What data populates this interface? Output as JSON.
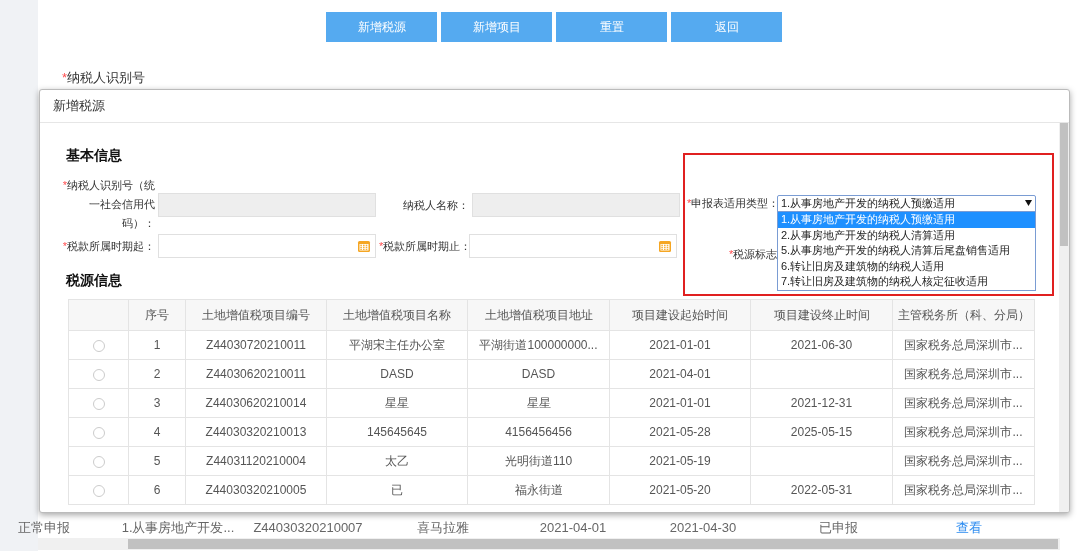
{
  "toolbar": {
    "buttons": [
      "新增税源",
      "新增项目",
      "重置",
      "返回"
    ]
  },
  "background_form": {
    "required_mark": "*",
    "label": "纳税人识别号"
  },
  "background_table_row": [
    "正常申报",
    "1.从事房地产开发...",
    "Z44030320210007",
    "喜马拉雅",
    "2021-04-01",
    "2021-04-30",
    "已申报"
  ],
  "background_table_link": "查看",
  "dialog": {
    "title": "新增税源",
    "basic_info": {
      "heading": "基本信息",
      "fields": [
        {
          "required_mark": "*",
          "label": "纳税人识别号（统一社会信用代码）：",
          "readonly": true,
          "kind": "text"
        },
        {
          "label": "纳税人名称：",
          "readonly": true,
          "kind": "text"
        },
        {
          "required_mark": "*",
          "label": "税款所属时期起：",
          "readonly": false,
          "kind": "date"
        },
        {
          "required_mark": "*",
          "label": "税款所属时期止：",
          "readonly": false,
          "kind": "date"
        }
      ],
      "declaration_type": {
        "required_mark": "*",
        "label": "申报表适用类型：",
        "value": "1.从事房地产开发的纳税人预缴适用",
        "expanded": true,
        "options": [
          {
            "text": "1.从事房地产开发的纳税人预缴适用",
            "selected": true
          },
          {
            "text": "2.从事房地产开发的纳税人清算适用",
            "selected": false
          },
          {
            "text": "5.从事房地产开发的纳税人清算后尾盘销售适用",
            "selected": false
          },
          {
            "text": "6.转让旧房及建筑物的纳税人适用",
            "selected": false
          },
          {
            "text": "7.转让旧房及建筑物的纳税人核定征收适用",
            "selected": false
          }
        ]
      },
      "tax_source_flag": {
        "required_mark": "*",
        "label": "税源标志"
      }
    },
    "tax_source_info": {
      "heading": "税源信息",
      "table": {
        "columns": [
          "序号",
          "土地增值税项目编号",
          "土地增值税项目名称",
          "土地增值税项目地址",
          "项目建设起始时间",
          "项目建设终止时间",
          "主管税务所（科、分局）"
        ],
        "rows": [
          {
            "selected": false,
            "cells": [
              "1",
              "Z44030720210011",
              "平湖宋主任办公室",
              "平湖街道100000000...",
              "2021-01-01",
              "2021-06-30",
              "国家税务总局深圳市..."
            ]
          },
          {
            "selected": false,
            "cells": [
              "2",
              "Z44030620210011",
              "DASD",
              "DASD",
              "2021-04-01",
              "",
              "国家税务总局深圳市..."
            ]
          },
          {
            "selected": false,
            "cells": [
              "3",
              "Z44030620210014",
              "星星",
              "星星",
              "2021-01-01",
              "2021-12-31",
              "国家税务总局深圳市..."
            ]
          },
          {
            "selected": false,
            "cells": [
              "4",
              "Z44030320210013",
              "145645645",
              "4156456456",
              "2021-05-28",
              "2025-05-15",
              "国家税务总局深圳市..."
            ]
          },
          {
            "selected": false,
            "cells": [
              "5",
              "Z44031120210004",
              "太乙",
              "光明街道110",
              "2021-05-19",
              "",
              "国家税务总局深圳市..."
            ]
          },
          {
            "selected": false,
            "cells": [
              "6",
              "Z44030320210005",
              "已",
              "福永街道",
              "2021-05-20",
              "2022-05-31",
              "国家税务总局深圳市..."
            ]
          }
        ]
      }
    }
  }
}
